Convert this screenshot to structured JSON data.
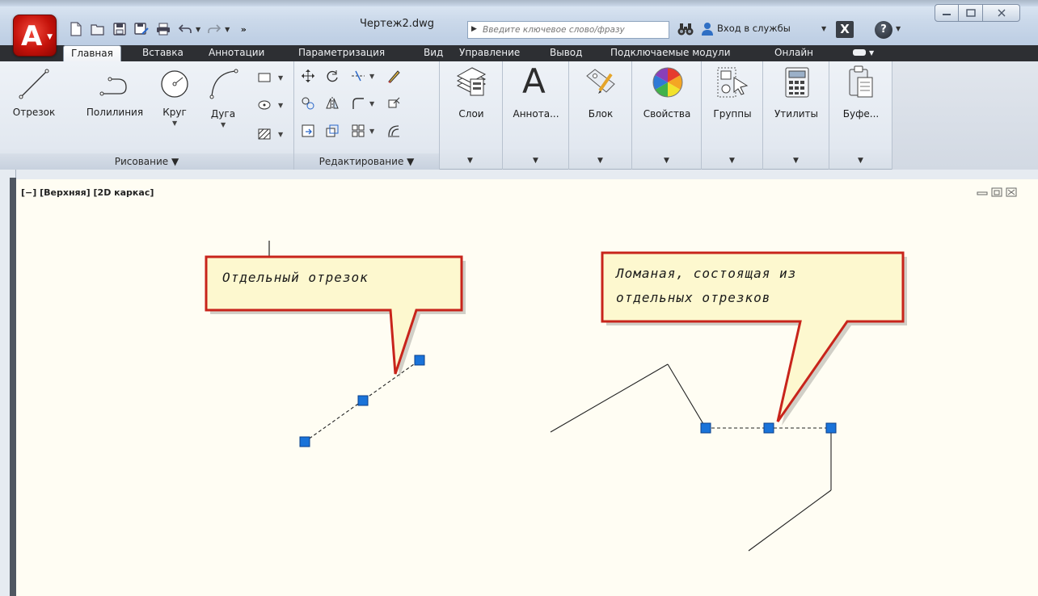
{
  "window": {
    "document_title": "Чертеж2.dwg",
    "search_placeholder": "Введите ключевое слово/фразу",
    "signin_label": "Вход в службы",
    "help_label": "?"
  },
  "tabs": [
    {
      "label": "Главная",
      "active": true
    },
    {
      "label": "Вставка"
    },
    {
      "label": "Аннотации"
    },
    {
      "label": "Параметризация"
    },
    {
      "label": "Вид"
    },
    {
      "label": "Управление"
    },
    {
      "label": "Вывод"
    },
    {
      "label": "Подключаемые модули"
    },
    {
      "label": "Онлайн"
    }
  ],
  "ribbon": {
    "draw": {
      "tools": [
        "Отрезок",
        "Полилиния",
        "Круг",
        "Дуга"
      ],
      "footer": "Рисование ▼"
    },
    "modify": {
      "footer": "Редактирование ▼"
    },
    "panels": [
      "Слои",
      "Аннота...",
      "Блок",
      "Свойства",
      "Группы",
      "Утилиты",
      "Буфе..."
    ]
  },
  "viewport": {
    "label": "[−] [Верхняя] [2D каркас]"
  },
  "callouts": {
    "left": [
      "Отдельный отрезок"
    ],
    "right": [
      "Ломаная, состоящая из",
      "отдельных отрезков"
    ]
  },
  "colors": {
    "canvas_bg": "#fffdf3",
    "callout_fill": "#fdf8cf",
    "callout_border": "#c8241b",
    "grip_fill": "#1a73d9",
    "tab_bar": "#2d2f33",
    "app_button": "#c4120a"
  }
}
